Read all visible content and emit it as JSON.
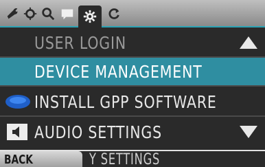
{
  "tabs": [
    {
      "name": "wrench-icon",
      "active": false
    },
    {
      "name": "tools-icon",
      "active": false
    },
    {
      "name": "search-icon",
      "active": false
    },
    {
      "name": "message-icon",
      "active": false
    },
    {
      "name": "gear-icon",
      "active": true
    },
    {
      "name": "refresh-icon",
      "active": false
    }
  ],
  "tab_label": "",
  "menu": {
    "items": [
      {
        "label": "USER LOGIN",
        "icon": "",
        "selected": false
      },
      {
        "label": "DEVICE MANAGEMENT",
        "icon": "",
        "selected": true
      },
      {
        "label": "INSTALL GPP SOFTWARE",
        "icon": "blue-disc-icon",
        "selected": false
      },
      {
        "label": "AUDIO SETTINGS",
        "icon": "speaker-icon",
        "selected": false
      }
    ],
    "scroll_up": "up-arrow-icon",
    "scroll_down": "down-arrow-icon"
  },
  "bottom": {
    "back_label": "BACK",
    "partial_row_label": "Y SETTINGS"
  },
  "colors": {
    "accent": "#2f8ea1",
    "tab_label": "#c4352a"
  }
}
